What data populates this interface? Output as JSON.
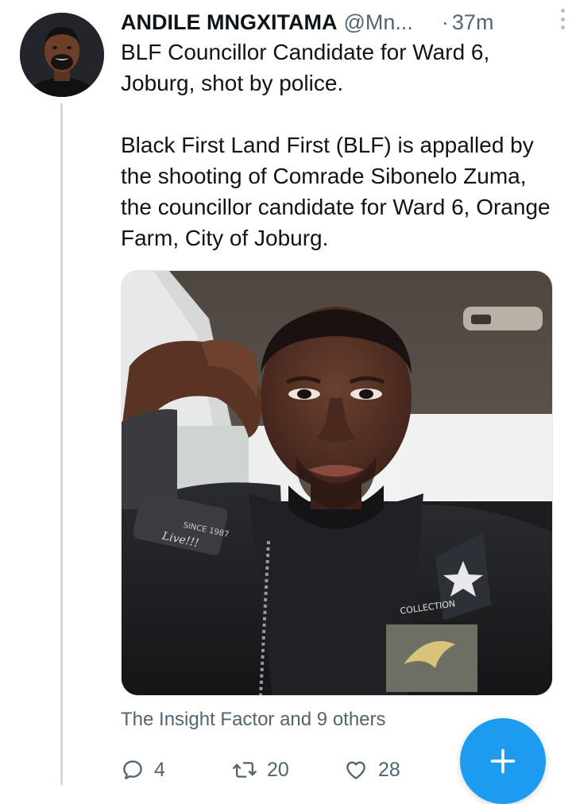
{
  "tweet": {
    "author": {
      "display_name": "ANDILE MNGXITAMA",
      "handle": "@Mn...",
      "avatar": "profile-photo"
    },
    "separator": "·",
    "time": "37m",
    "text_paragraphs": [
      "BLF Councillor Candidate for Ward 6, Joburg, shot by police.",
      "Black First Land First (BLF) is appalled by the shooting of Comrade Sibonelo Zuma, the councillor candidate for Ward 6, Orange Farm, City of Joburg."
    ],
    "media": {
      "type": "photo",
      "patch_text_1": "SINCE 1987",
      "patch_text_2": "Live!!!",
      "badge_text": "COLLECTION"
    },
    "social_context": "The Insight Factor and 9 others",
    "actions": {
      "reply": {
        "icon": "reply-icon",
        "count": "4"
      },
      "retweet": {
        "icon": "retweet-icon",
        "count": "20"
      },
      "like": {
        "icon": "heart-icon",
        "count": "28"
      }
    }
  },
  "more_menu_icon": "more-vertical-icon",
  "compose_button": {
    "icon": "plus-icon"
  },
  "colors": {
    "accent": "#1d9bf0",
    "secondary_text": "#536471",
    "primary_text": "#0f1419",
    "thread_line": "#cfd9de"
  }
}
